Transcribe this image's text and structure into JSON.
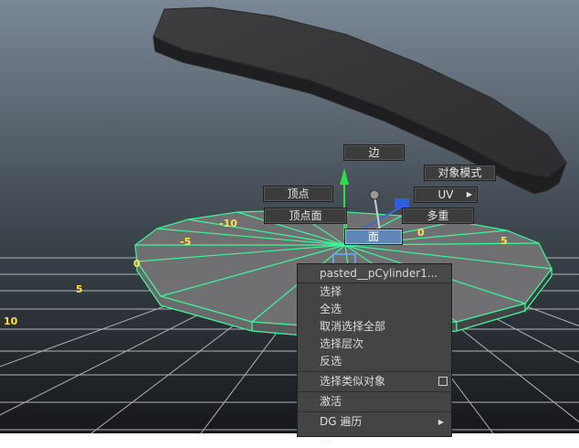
{
  "viewport": {
    "grid_labels": [
      "-10",
      "-5",
      "0",
      "5",
      "5",
      "10",
      "0"
    ]
  },
  "marking_menu": {
    "north": "边",
    "northeast": "对象模式",
    "east": "UV",
    "west": "顶点",
    "southwest": "顶点面",
    "southeast": "多重",
    "south": "面"
  },
  "context_menu": {
    "header": "pasted__pCylinder1...",
    "items": [
      "选择",
      "全选",
      "取消选择全部",
      "选择层次",
      "反选"
    ],
    "select_similar": "选择类似对象",
    "activate": "激活",
    "dg_traverse": "DG 遍历",
    "truncated_item": "…"
  },
  "colors": {
    "viewport_top": "#7a8896",
    "viewport_bottom": "#171a1d",
    "wire_highlight": "#3df59a",
    "grid_number": "#ffe14a",
    "menu_highlight": "#5f86b4"
  }
}
